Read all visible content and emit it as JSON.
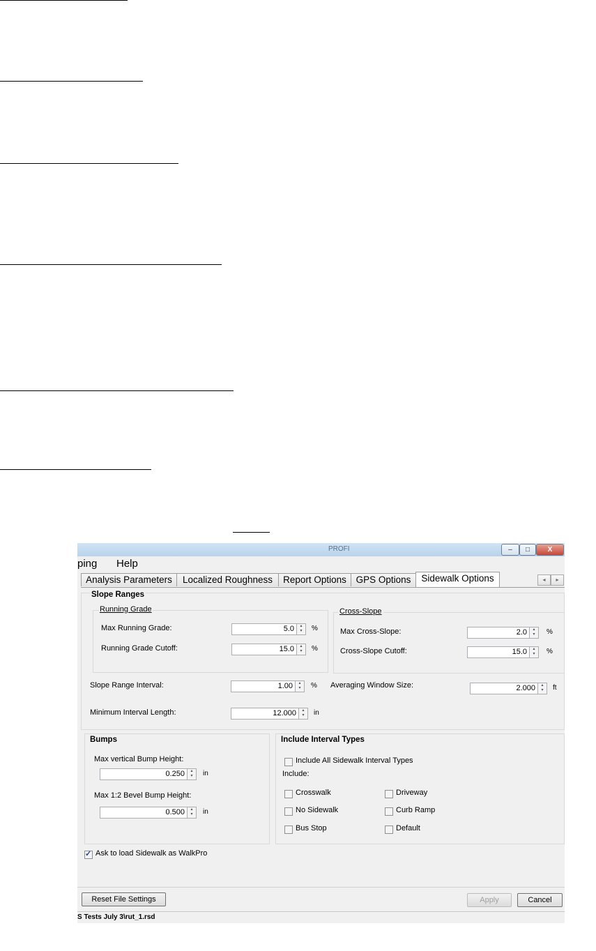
{
  "window": {
    "title": "PROFI",
    "minimize_glyph": "–",
    "maximize_glyph": "□",
    "close_glyph": "X"
  },
  "menu": {
    "items": [
      "ping",
      "Help"
    ]
  },
  "tabs": [
    {
      "label": "Analysis Parameters"
    },
    {
      "label": "Localized Roughness"
    },
    {
      "label": "Report Options"
    },
    {
      "label": "GPS Options"
    },
    {
      "label": "Sidewalk Options",
      "active": true
    }
  ],
  "tab_scroll": {
    "left": "◂",
    "right": "▸"
  },
  "slope_ranges": {
    "title": "Slope Ranges",
    "running_grade": {
      "title": "Running Grade",
      "max_label": "Max Running Grade:",
      "max_value": "5.0",
      "max_unit": "%",
      "cutoff_label": "Running Grade Cutoff:",
      "cutoff_value": "15.0",
      "cutoff_unit": "%"
    },
    "cross_slope": {
      "title": "Cross-Slope",
      "max_label": "Max Cross-Slope:",
      "max_value": "2.0",
      "max_unit": "%",
      "cutoff_label": "Cross-Slope Cutoff:",
      "cutoff_value": "15.0",
      "cutoff_unit": "%"
    },
    "interval_label": "Slope Range Interval:",
    "interval_value": "1.00",
    "interval_unit": "%",
    "averaging_label": "Averaging Window Size:",
    "averaging_value": "2.000",
    "averaging_unit": "ft",
    "min_interval_label": "Minimum Interval Length:",
    "min_interval_value": "12.000",
    "min_interval_unit": "in"
  },
  "bumps": {
    "title": "Bumps",
    "vertical_label": "Max vertical Bump Height:",
    "vertical_value": "0.250",
    "vertical_unit": "in",
    "bevel_label": "Max 1:2 Bevel Bump Height:",
    "bevel_value": "0.500",
    "bevel_unit": "in"
  },
  "interval_types": {
    "title": "Include Interval Types",
    "include_all_label": "Include All Sidewalk Interval Types",
    "include_all_checked": false,
    "include_label": "Include:",
    "types": [
      {
        "label": "Crosswalk",
        "checked": false
      },
      {
        "label": "Driveway",
        "checked": false
      },
      {
        "label": "No Sidewalk",
        "checked": false
      },
      {
        "label": "Curb Ramp",
        "checked": false
      },
      {
        "label": "Bus Stop",
        "checked": false
      },
      {
        "label": "Default",
        "checked": false
      }
    ]
  },
  "ask_walkpro": {
    "label": "Ask to load Sidewalk as WalkPro",
    "checked": true
  },
  "buttons": {
    "reset": "Reset File Settings",
    "apply": "Apply",
    "cancel": "Cancel"
  },
  "status": {
    "path": "S Tests July 3\\rut_1.rsd"
  },
  "spinner_glyphs": {
    "up": "▴",
    "down": "▾"
  }
}
